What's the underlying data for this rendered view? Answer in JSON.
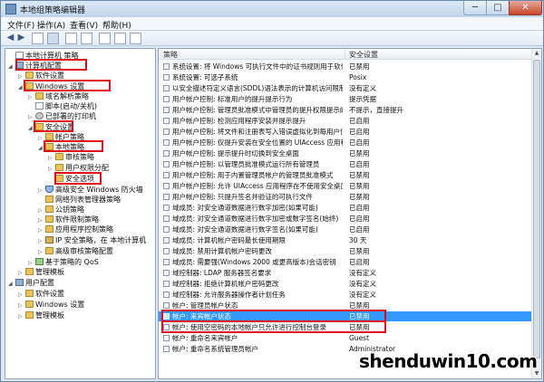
{
  "window": {
    "title": "本地组策略编辑器",
    "minimize_glyph": "─",
    "maximize_glyph": "□",
    "close_glyph": "✕"
  },
  "menu": [
    "文件(F)",
    "操作(A)",
    "查看(V)",
    "帮助(H)"
  ],
  "toolbar": {
    "back_glyph": "◀",
    "forward_glyph": "▶",
    "icons": [
      "up-folder-icon",
      "show-hide-tree-icon",
      "delete-icon",
      "properties-icon",
      "export-icon",
      "help-icon",
      "view-icon"
    ]
  },
  "tree": [
    {
      "label": "本地计算机 策略",
      "icon": "policy-icon",
      "arrow": ""
    },
    {
      "label": "计算机配置",
      "icon": "computer-icon",
      "arrow": "◢"
    },
    {
      "label": "软件设置",
      "icon": "folder-icon",
      "arrow": "▷"
    },
    {
      "label": "Windows 设置",
      "icon": "folder-icon",
      "arrow": "◢"
    },
    {
      "label": "域名解析策略",
      "icon": "folder-icon",
      "arrow": "▷"
    },
    {
      "label": "脚本(启动/关机)",
      "icon": "script-icon",
      "arrow": ""
    },
    {
      "label": "已部署的打印机",
      "icon": "printer-icon",
      "arrow": "▷"
    },
    {
      "label": "安全设置",
      "icon": "folder-icon",
      "arrow": "◢"
    },
    {
      "label": "帐户策略",
      "icon": "folder-icon",
      "arrow": "▷"
    },
    {
      "label": "本地策略",
      "icon": "folder-icon",
      "arrow": "◢"
    },
    {
      "label": "审核策略",
      "icon": "folder-icon",
      "arrow": "▷"
    },
    {
      "label": "用户权限分配",
      "icon": "folder-icon",
      "arrow": "▷"
    },
    {
      "label": "安全选项",
      "icon": "folder-icon",
      "arrow": ""
    },
    {
      "label": "高级安全 Windows 防火墙",
      "icon": "firewall-icon",
      "arrow": "▷"
    },
    {
      "label": "网络列表管理器策略",
      "icon": "folder-icon",
      "arrow": ""
    },
    {
      "label": "公钥策略",
      "icon": "folder-icon",
      "arrow": "▷"
    },
    {
      "label": "软件限制策略",
      "icon": "folder-icon",
      "arrow": "▷"
    },
    {
      "label": "应用程序控制策略",
      "icon": "folder-icon",
      "arrow": "▷"
    },
    {
      "label": "IP 安全策略，在 本地计算机",
      "icon": "ipsec-icon",
      "arrow": "▷"
    },
    {
      "label": "高级审核策略配置",
      "icon": "folder-icon",
      "arrow": "▷"
    },
    {
      "label": "基于策略的 QoS",
      "icon": "qos-icon",
      "arrow": "▷"
    },
    {
      "label": "管理模板",
      "icon": "folder-icon",
      "arrow": "▷"
    },
    {
      "label": "用户配置",
      "icon": "user-icon",
      "arrow": "◢"
    },
    {
      "label": "软件设置",
      "icon": "folder-icon",
      "arrow": "▷"
    },
    {
      "label": "Windows 设置",
      "icon": "folder-icon",
      "arrow": "▷"
    },
    {
      "label": "管理模板",
      "icon": "folder-icon",
      "arrow": "▷"
    }
  ],
  "list": {
    "columns": [
      "策略",
      "安全设置"
    ],
    "rows": [
      {
        "name": "系统设置: 将 Windows 可执行文件中的证书规则用于软件...",
        "value": "已禁用"
      },
      {
        "name": "系统设置: 可选子系统",
        "value": "Posix"
      },
      {
        "name": "以安全描述符定义语言(SDDL)语法表示的计算机访问限制",
        "value": "没有定义"
      },
      {
        "name": "用户帐户控制: 标准用户的提升提示行为",
        "value": "提示凭据"
      },
      {
        "name": "用户帐户控制: 管理员批准模式中管理员的提升权限提示的...",
        "value": "不提示，直接提升"
      },
      {
        "name": "用户帐户控制: 检测应用程序安装并提示提升",
        "value": "已启用"
      },
      {
        "name": "用户帐户控制: 将文件和注册表写入错误虚拟化到每用户位置",
        "value": "已启用"
      },
      {
        "name": "用户帐户控制: 仅提升安装在安全位置的 UIAccess 应用程序",
        "value": "已启用"
      },
      {
        "name": "用户帐户控制: 提示提升时切换到安全桌面",
        "value": "已禁用"
      },
      {
        "name": "用户帐户控制: 以管理员批准模式运行所有管理员",
        "value": "已启用"
      },
      {
        "name": "用户帐户控制: 用于内置管理员帐户的管理员批准模式",
        "value": "已禁用"
      },
      {
        "name": "用户帐户控制: 允许 UIAccess 应用程序在不使用安全桌面...",
        "value": "已禁用"
      },
      {
        "name": "用户帐户控制: 只提升签名并验证的可执行文件",
        "value": "已禁用"
      },
      {
        "name": "域成员: 对安全通道数据进行数字加密(如果可能)",
        "value": "已启用"
      },
      {
        "name": "域成员: 对安全通道数据进行数字加密或数字签名(始终)",
        "value": "已启用"
      },
      {
        "name": "域成员: 对安全通道数据进行数字签名(如果可能)",
        "value": "已启用"
      },
      {
        "name": "域成员: 计算机帐户密码最长使用期限",
        "value": "30 天"
      },
      {
        "name": "域成员: 禁用计算机帐户密码更改",
        "value": "已禁用"
      },
      {
        "name": "域成员: 需要强(Windows 2000 或更高版本)会话密钥",
        "value": "已启用"
      },
      {
        "name": "域控制器: LDAP 服务器签名要求",
        "value": "没有定义"
      },
      {
        "name": "域控制器: 拒绝计算机帐户密码更改",
        "value": "没有定义"
      },
      {
        "name": "域控制器: 允许服务器操作者计划任务",
        "value": "没有定义"
      },
      {
        "name": "帐户: 管理员帐户状态",
        "value": "已禁用"
      },
      {
        "name": "帐户: 来宾帐户状态",
        "value": "已禁用",
        "selected": true
      },
      {
        "name": "帐户: 使用空密码的本地帐户只允许进行控制台登录",
        "value": "已禁用"
      },
      {
        "name": "帐户: 重命名来宾帐户",
        "value": "Guest"
      },
      {
        "name": "帐户: 重命名系统管理员帐户",
        "value": "Administrator"
      }
    ]
  },
  "scroll": {
    "up_glyph": "▲",
    "down_glyph": "▼"
  },
  "watermark": "shenduwin10.com",
  "colors": {
    "highlight": "#e00b16",
    "selection": "#3399ff"
  }
}
